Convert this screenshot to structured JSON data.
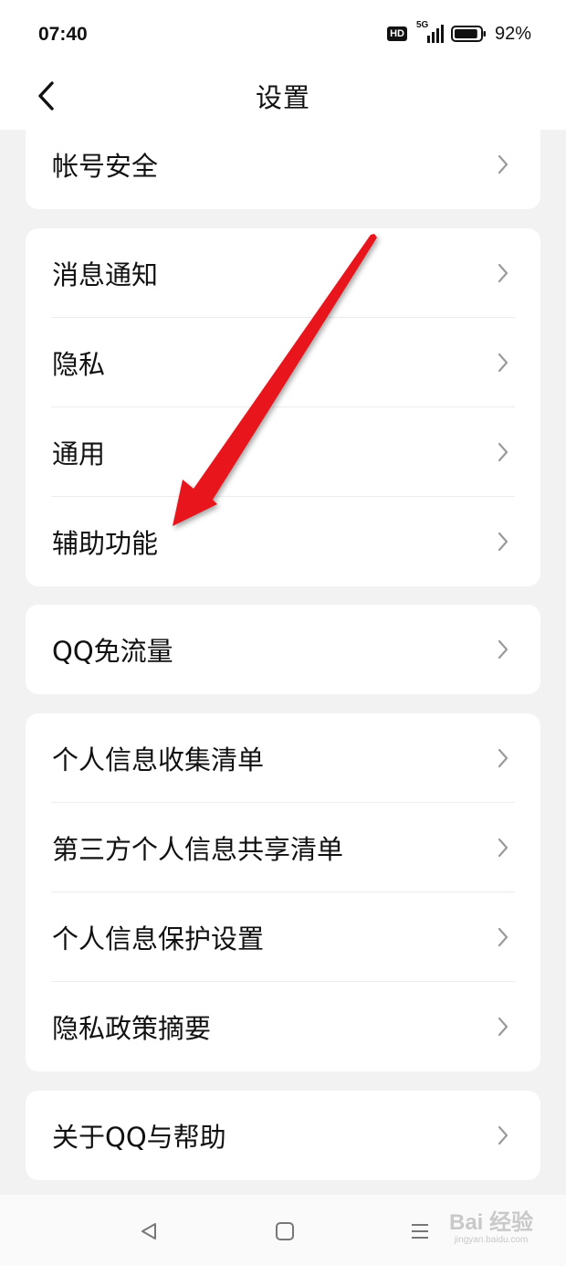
{
  "status_bar": {
    "time": "07:40",
    "hd_badge": "HD",
    "network": "5G",
    "battery_percent": "92%",
    "battery_level": 0.92
  },
  "header": {
    "title": "设置",
    "back_icon": "chevron-left-icon"
  },
  "sections": [
    {
      "items": [
        {
          "label": "帐号安全"
        }
      ]
    },
    {
      "items": [
        {
          "label": "消息通知"
        },
        {
          "label": "隐私"
        },
        {
          "label": "通用"
        },
        {
          "label": "辅助功能"
        }
      ]
    },
    {
      "items": [
        {
          "label": "QQ免流量"
        }
      ]
    },
    {
      "items": [
        {
          "label": "个人信息收集清单"
        },
        {
          "label": "第三方个人信息共享清单"
        },
        {
          "label": "个人信息保护设置"
        },
        {
          "label": "隐私政策摘要"
        }
      ]
    },
    {
      "items": [
        {
          "label": "关于QQ与帮助"
        }
      ]
    }
  ],
  "system_nav": {
    "back_icon": "triangle-back-icon",
    "home_icon": "square-home-icon",
    "menu_icon": "menu-icon"
  },
  "watermark": {
    "main": "Bai 经验",
    "sub": "jingyan.baidu.com"
  },
  "annotation": {
    "arrow_color": "#e8141b"
  }
}
